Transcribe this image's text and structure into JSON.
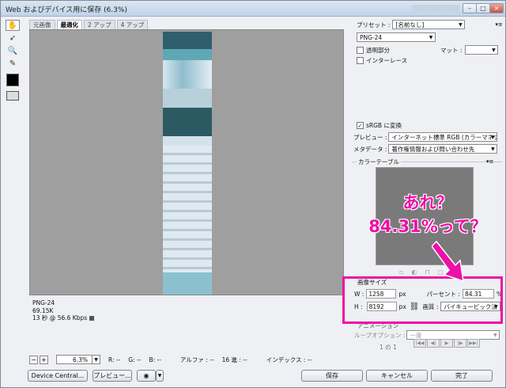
{
  "window": {
    "title": "Web およびデバイス用に保存 (6.3%)",
    "minimize_glyph": "–",
    "maximize_glyph": "□",
    "close_glyph": "×"
  },
  "tabs": [
    "元画像",
    "最適化",
    "2 アップ",
    "4 アップ"
  ],
  "image_info": {
    "format": "PNG-24",
    "size": "69.15K",
    "time": "13 秒 @ 56.6 Kbps"
  },
  "status": {
    "zoom": "6.3%",
    "r": "R: --",
    "g": "G: --",
    "b": "B: --",
    "alpha": "アルファ : --",
    "hex": "16 進 : --",
    "index": "インデックス : --"
  },
  "buttons": {
    "device_central": "Device Central...",
    "preview": "プレビュー...",
    "save": "保存",
    "cancel": "キャンセル",
    "done": "完了"
  },
  "settings": {
    "preset_label": "プリセット :",
    "preset_value": "[名前なし]",
    "format_value": "PNG-24",
    "transparency_label": "透明部分",
    "matte_label": "マット :",
    "interlace_label": "インターレース",
    "srgb_label": "sRGB に変換",
    "preview_label": "プレビュー :",
    "preview_value": "インターネット標準 RGB (カラーマネジメ...",
    "metadata_label": "メタデータ :",
    "metadata_value": "著作権情報および問い合わせ先",
    "color_table_label": "カラーテーブル"
  },
  "image_size": {
    "section_label": "画像サイズ",
    "w_label": "W :",
    "w_value": "1258",
    "h_label": "H :",
    "h_value": "8192",
    "unit": "px",
    "percent_label": "パーセント :",
    "percent_value": "84.31",
    "percent_unit": "%",
    "quality_label": "画質 :",
    "quality_value": "バイキュービック法"
  },
  "animation": {
    "section_label": "アニメーション",
    "loop_label": "ループオプション :",
    "loop_value": "一度",
    "frame": "1 の 1"
  },
  "annotation": {
    "line1": "あれ？",
    "line2": "84.31%って？",
    "color": "#ee0ea8"
  }
}
